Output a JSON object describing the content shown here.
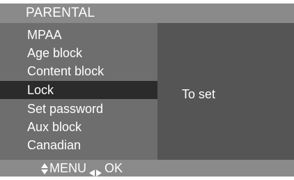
{
  "title": "PARENTAL",
  "menu": {
    "items": [
      {
        "label": "MPAA"
      },
      {
        "label": "Age block"
      },
      {
        "label": "Content block"
      },
      {
        "label": "Lock"
      },
      {
        "label": "Set password"
      },
      {
        "label": "Aux block"
      },
      {
        "label": "Canadian"
      }
    ]
  },
  "detail": {
    "text": "To set"
  },
  "footer": {
    "navigate_icon": "up-down-arrows-icon",
    "menu_label": "MENU",
    "adjust_icon": "left-right-arrows-icon",
    "ok_label": "OK"
  },
  "colors": {
    "frame": "#4e4e4e",
    "bar": "#8a8a8a",
    "menu_panel": "#6e6e6e",
    "detail_panel": "#555555",
    "selected_row": "#2b2b2b",
    "text": "#ffffff"
  }
}
